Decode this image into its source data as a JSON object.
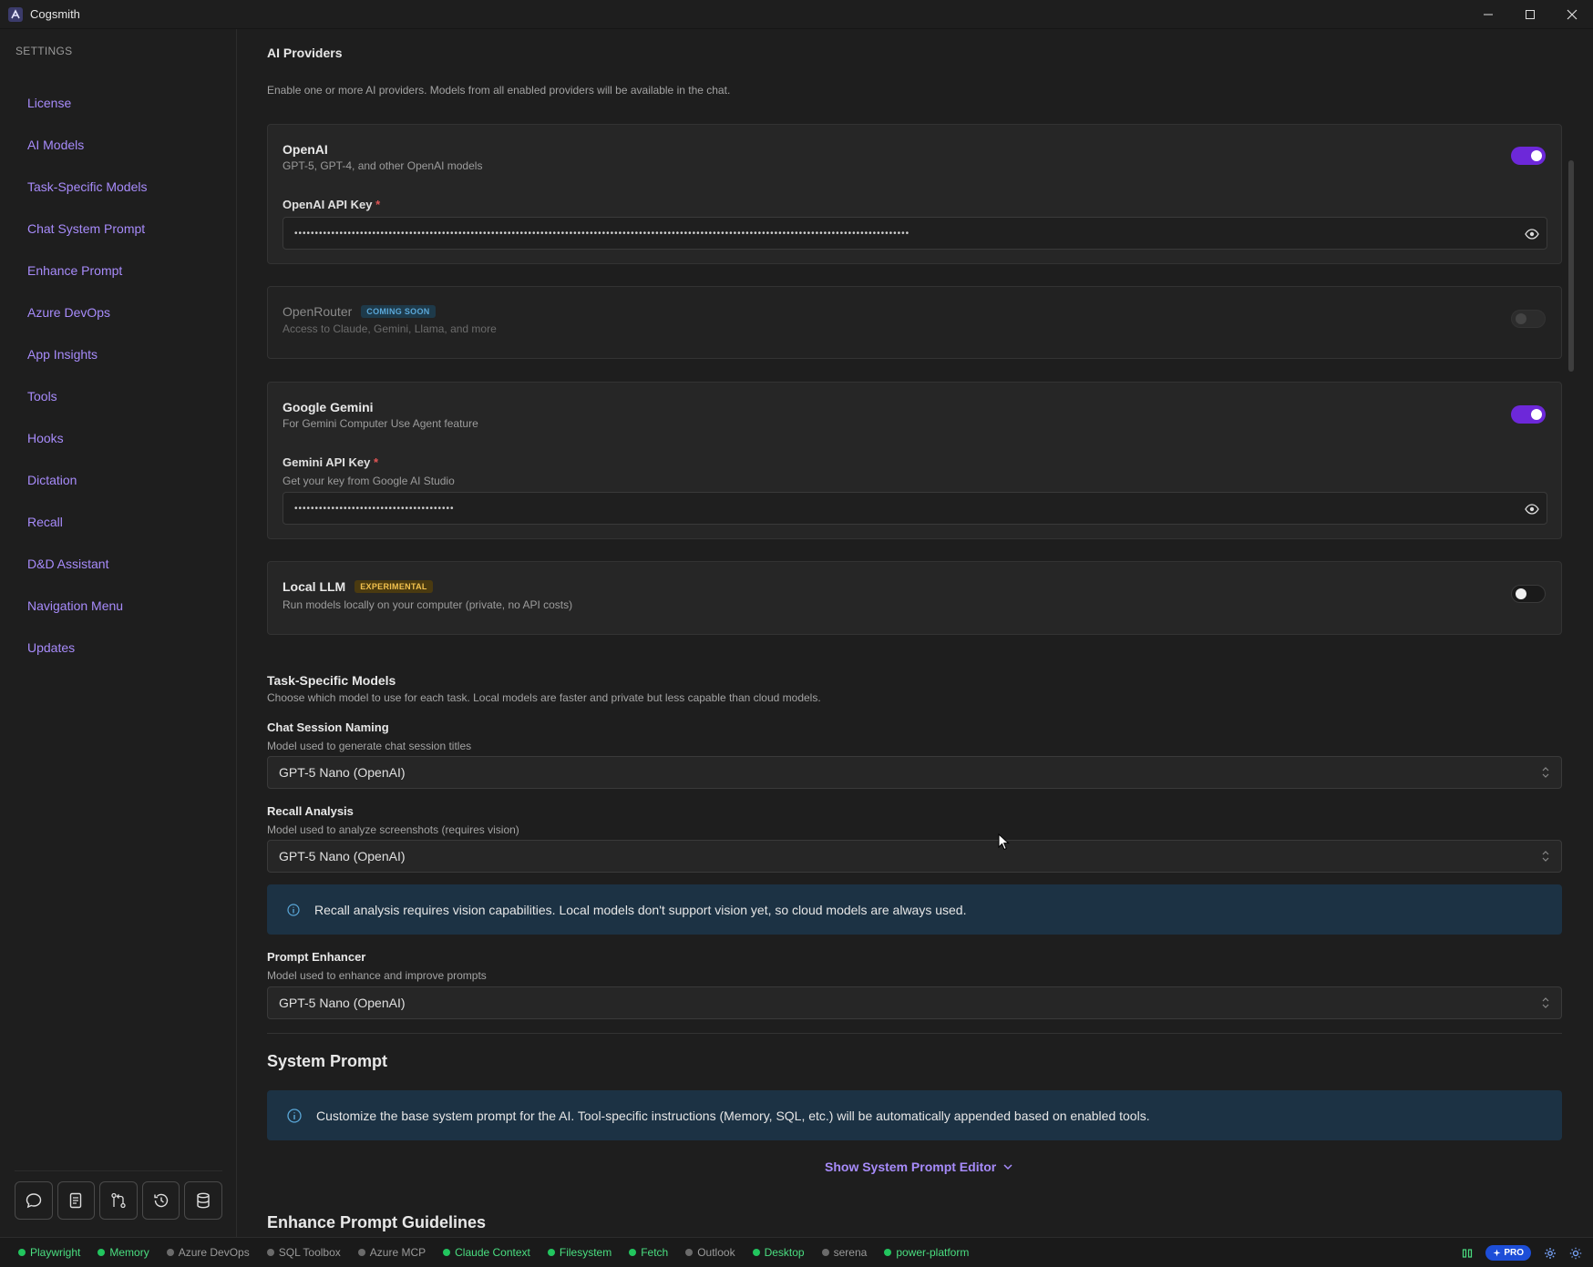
{
  "window": {
    "title": "Cogsmith"
  },
  "sidebar": {
    "heading": "SETTINGS",
    "items": [
      {
        "label": "License"
      },
      {
        "label": "AI Models"
      },
      {
        "label": "Task-Specific Models"
      },
      {
        "label": "Chat System Prompt"
      },
      {
        "label": "Enhance Prompt"
      },
      {
        "label": "Azure DevOps"
      },
      {
        "label": "App Insights"
      },
      {
        "label": "Tools"
      },
      {
        "label": "Hooks"
      },
      {
        "label": "Dictation"
      },
      {
        "label": "Recall"
      },
      {
        "label": "D&D Assistant"
      },
      {
        "label": "Navigation Menu"
      },
      {
        "label": "Updates"
      }
    ],
    "actions": [
      "chat-icon",
      "document-icon",
      "git-compare-icon",
      "history-icon",
      "database-icon"
    ]
  },
  "providers": {
    "heading": "AI Providers",
    "description": "Enable one or more AI providers. Models from all enabled providers will be available in the chat.",
    "openai": {
      "name": "OpenAI",
      "description": "GPT-5, GPT-4, and other OpenAI models",
      "enabled": true,
      "key_label": "OpenAI API Key",
      "required_mark": "*",
      "key_value": "••••••••••••••••••••••••••••••••••••••••••••••••••••••••••••••••••••••••••••••••••••••••••••••••••••••••••••••••••••••••••••••••••••••••••••••••••••••"
    },
    "openrouter": {
      "name": "OpenRouter",
      "badge": "COMING SOON",
      "description": "Access to Claude, Gemini, Llama, and more",
      "enabled": false
    },
    "gemini": {
      "name": "Google Gemini",
      "description": "For Gemini Computer Use Agent feature",
      "enabled": true,
      "key_label": "Gemini API Key",
      "required_mark": "*",
      "key_hint": "Get your key from Google AI Studio",
      "key_value": "•••••••••••••••••••••••••••••••••••••••"
    },
    "local": {
      "name": "Local LLM",
      "badge": "EXPERIMENTAL",
      "description": "Run models locally on your computer (private, no API costs)",
      "enabled": false
    }
  },
  "task_models": {
    "heading": "Task-Specific Models",
    "description": "Choose which model to use for each task. Local models are faster and private but less capable than cloud models.",
    "chat_naming": {
      "label": "Chat Session Naming",
      "description": "Model used to generate chat session titles",
      "value": "GPT-5 Nano (OpenAI)"
    },
    "recall": {
      "label": "Recall Analysis",
      "description": "Model used to analyze screenshots (requires vision)",
      "value": "GPT-5 Nano (OpenAI)",
      "info": "Recall analysis requires vision capabilities. Local models don't support vision yet, so cloud models are always used."
    },
    "enhancer": {
      "label": "Prompt Enhancer",
      "description": "Model used to enhance and improve prompts",
      "value": "GPT-5 Nano (OpenAI)"
    }
  },
  "system_prompt": {
    "heading": "System Prompt",
    "info": "Customize the base system prompt for the AI. Tool-specific instructions (Memory, SQL, etc.) will be automatically appended based on enabled tools.",
    "show_editor": "Show System Prompt Editor",
    "next_heading": "Enhance Prompt Guidelines"
  },
  "statusbar": {
    "items": [
      {
        "label": "Playwright",
        "active": true
      },
      {
        "label": "Memory",
        "active": true
      },
      {
        "label": "Azure DevOps",
        "active": false
      },
      {
        "label": "SQL Toolbox",
        "active": false
      },
      {
        "label": "Azure MCP",
        "active": false
      },
      {
        "label": "Claude Context",
        "active": true
      },
      {
        "label": "Filesystem",
        "active": true
      },
      {
        "label": "Fetch",
        "active": true
      },
      {
        "label": "Outlook",
        "active": false
      },
      {
        "label": "Desktop",
        "active": true
      },
      {
        "label": "serena",
        "active": false
      },
      {
        "label": "power-platform",
        "active": true
      }
    ],
    "pro_label": "PRO"
  },
  "colors": {
    "accent": "#a78bfa",
    "toggle_on": "#6d28d9",
    "status_active": "#22c55e",
    "status_inactive": "#6b6b6b",
    "info_bg": "#1c3244"
  }
}
